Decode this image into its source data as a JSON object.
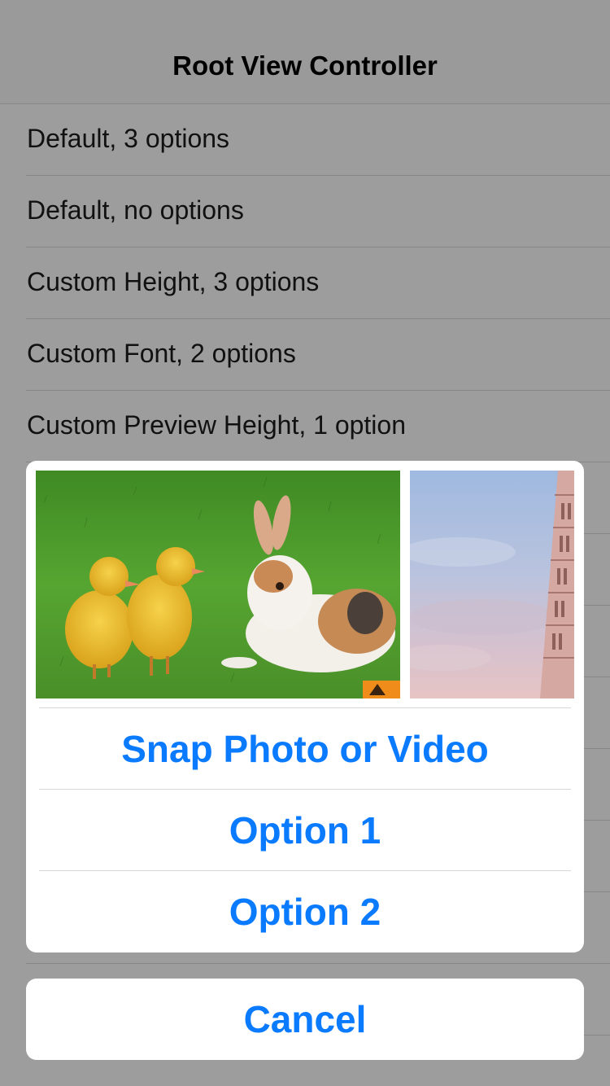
{
  "navbar": {
    "title": "Root View Controller"
  },
  "table": {
    "rows": [
      {
        "label": "Default, 3 options"
      },
      {
        "label": "Default, no options"
      },
      {
        "label": "Custom Height, 3 options"
      },
      {
        "label": "Custom Font, 2 options"
      },
      {
        "label": "Custom Preview Height, 1 option"
      },
      {
        "label": ""
      },
      {
        "label": ""
      },
      {
        "label": ""
      },
      {
        "label": ""
      },
      {
        "label": ""
      },
      {
        "label": ""
      },
      {
        "label": ""
      },
      {
        "label": ""
      }
    ]
  },
  "action_sheet": {
    "preview_photos": [
      {
        "name": "ducklings-and-rabbit-photo"
      },
      {
        "name": "leaning-tower-photo"
      }
    ],
    "actions": [
      {
        "label": "Snap Photo or Video"
      },
      {
        "label": "Option 1"
      },
      {
        "label": "Option 2"
      }
    ],
    "cancel_label": "Cancel"
  },
  "colors": {
    "accent": "#0a7aff",
    "dim_background": "#9d9d9d",
    "sheet_background": "#ffffff"
  }
}
